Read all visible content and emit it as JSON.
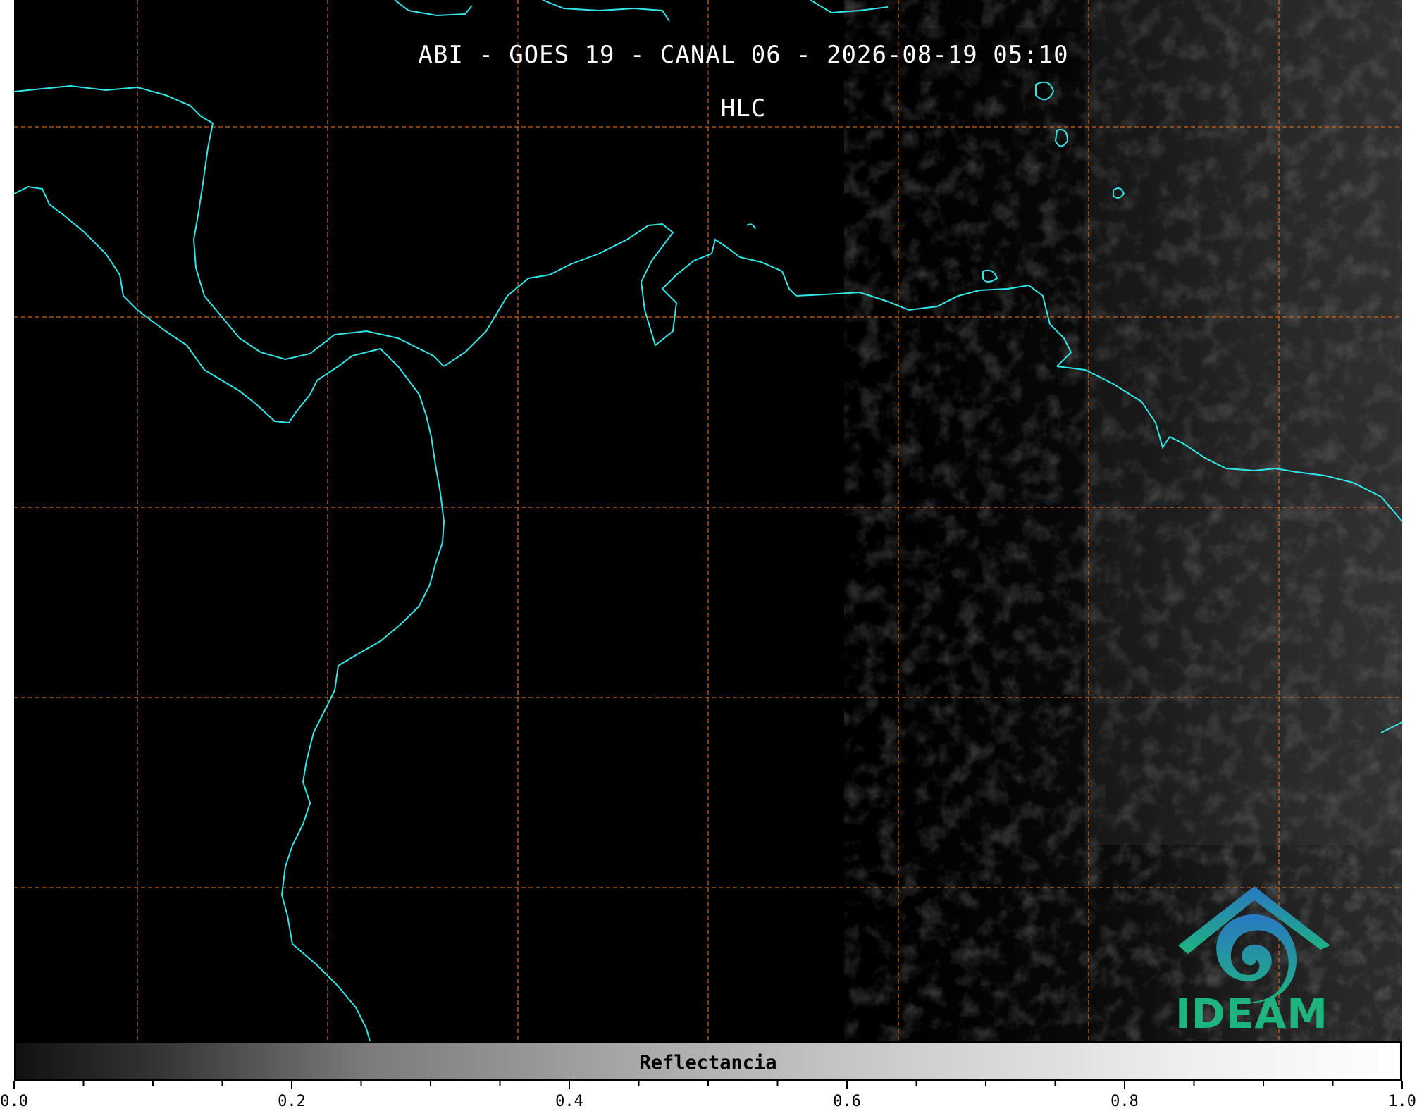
{
  "title": "ABI - GOES 19 - CANAL 06 - 2026-08-19 05:10 HLC",
  "colorbar": {
    "label": "Reflectancia",
    "ticks": [
      "0.0",
      "0.2",
      "0.4",
      "0.6",
      "0.8",
      "1.0"
    ],
    "range": [
      0.0,
      1.0
    ]
  },
  "logo": {
    "text": "IDEAM"
  },
  "colors": {
    "coastline": "#33e6e6",
    "gridlines": "#c8641e",
    "background": "#000000"
  }
}
